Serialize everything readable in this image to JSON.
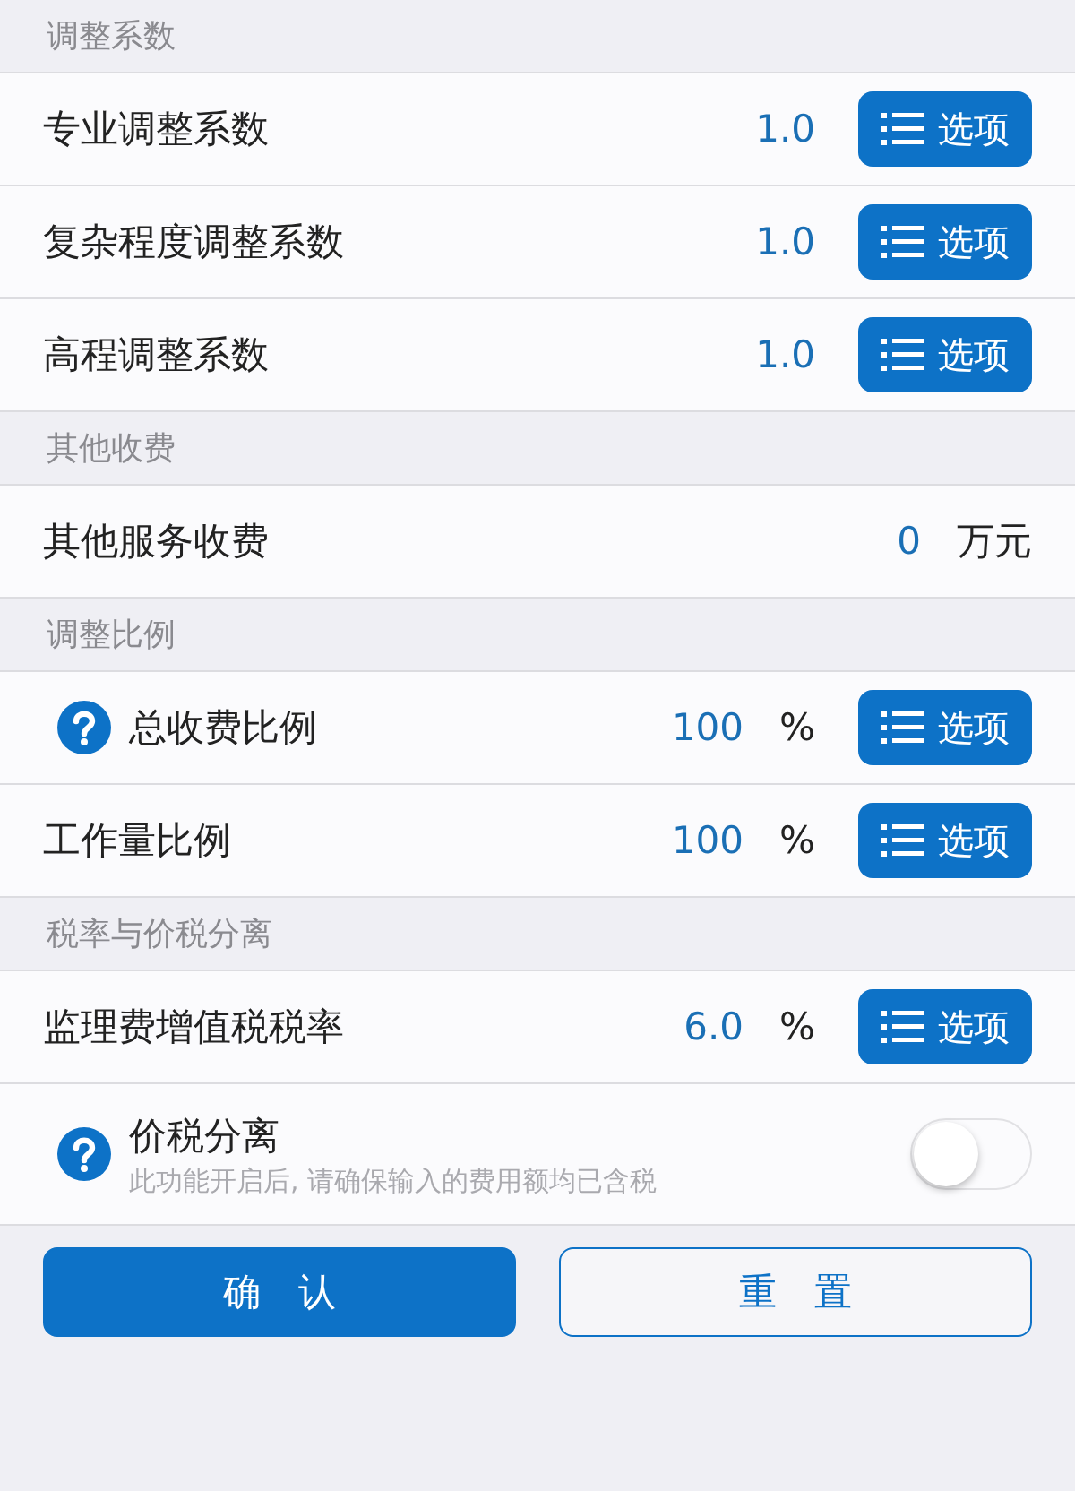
{
  "sections": [
    {
      "header": "调整系数",
      "rows": [
        {
          "kind": "option",
          "label": "专业调整系数",
          "value": "1.0",
          "button": "选项"
        },
        {
          "kind": "option",
          "label": "复杂程度调整系数",
          "value": "1.0",
          "button": "选项"
        },
        {
          "kind": "option",
          "label": "高程调整系数",
          "value": "1.0",
          "button": "选项"
        }
      ]
    },
    {
      "header": "其他收费",
      "rows": [
        {
          "kind": "unit",
          "label": "其他服务收费",
          "value": "0",
          "unit": "万元"
        }
      ]
    },
    {
      "header": "调整比例",
      "rows": [
        {
          "kind": "option",
          "help": true,
          "label": "总收费比例",
          "value": "100",
          "unit": "%",
          "button": "选项"
        },
        {
          "kind": "option",
          "label": "工作量比例",
          "value": "100",
          "unit": "%",
          "button": "选项"
        }
      ]
    },
    {
      "header": "税率与价税分离",
      "rows": [
        {
          "kind": "option",
          "label": "监理费增值税税率",
          "value": "6.0",
          "unit": "%",
          "button": "选项"
        },
        {
          "kind": "toggle",
          "help": true,
          "label": "价税分离",
          "note": "此功能开启后, 请确保输入的费用额均已含税",
          "on": false
        }
      ]
    }
  ],
  "actions": [
    {
      "label": "确　认",
      "primary": true
    },
    {
      "label": "重　置",
      "primary": false
    }
  ]
}
